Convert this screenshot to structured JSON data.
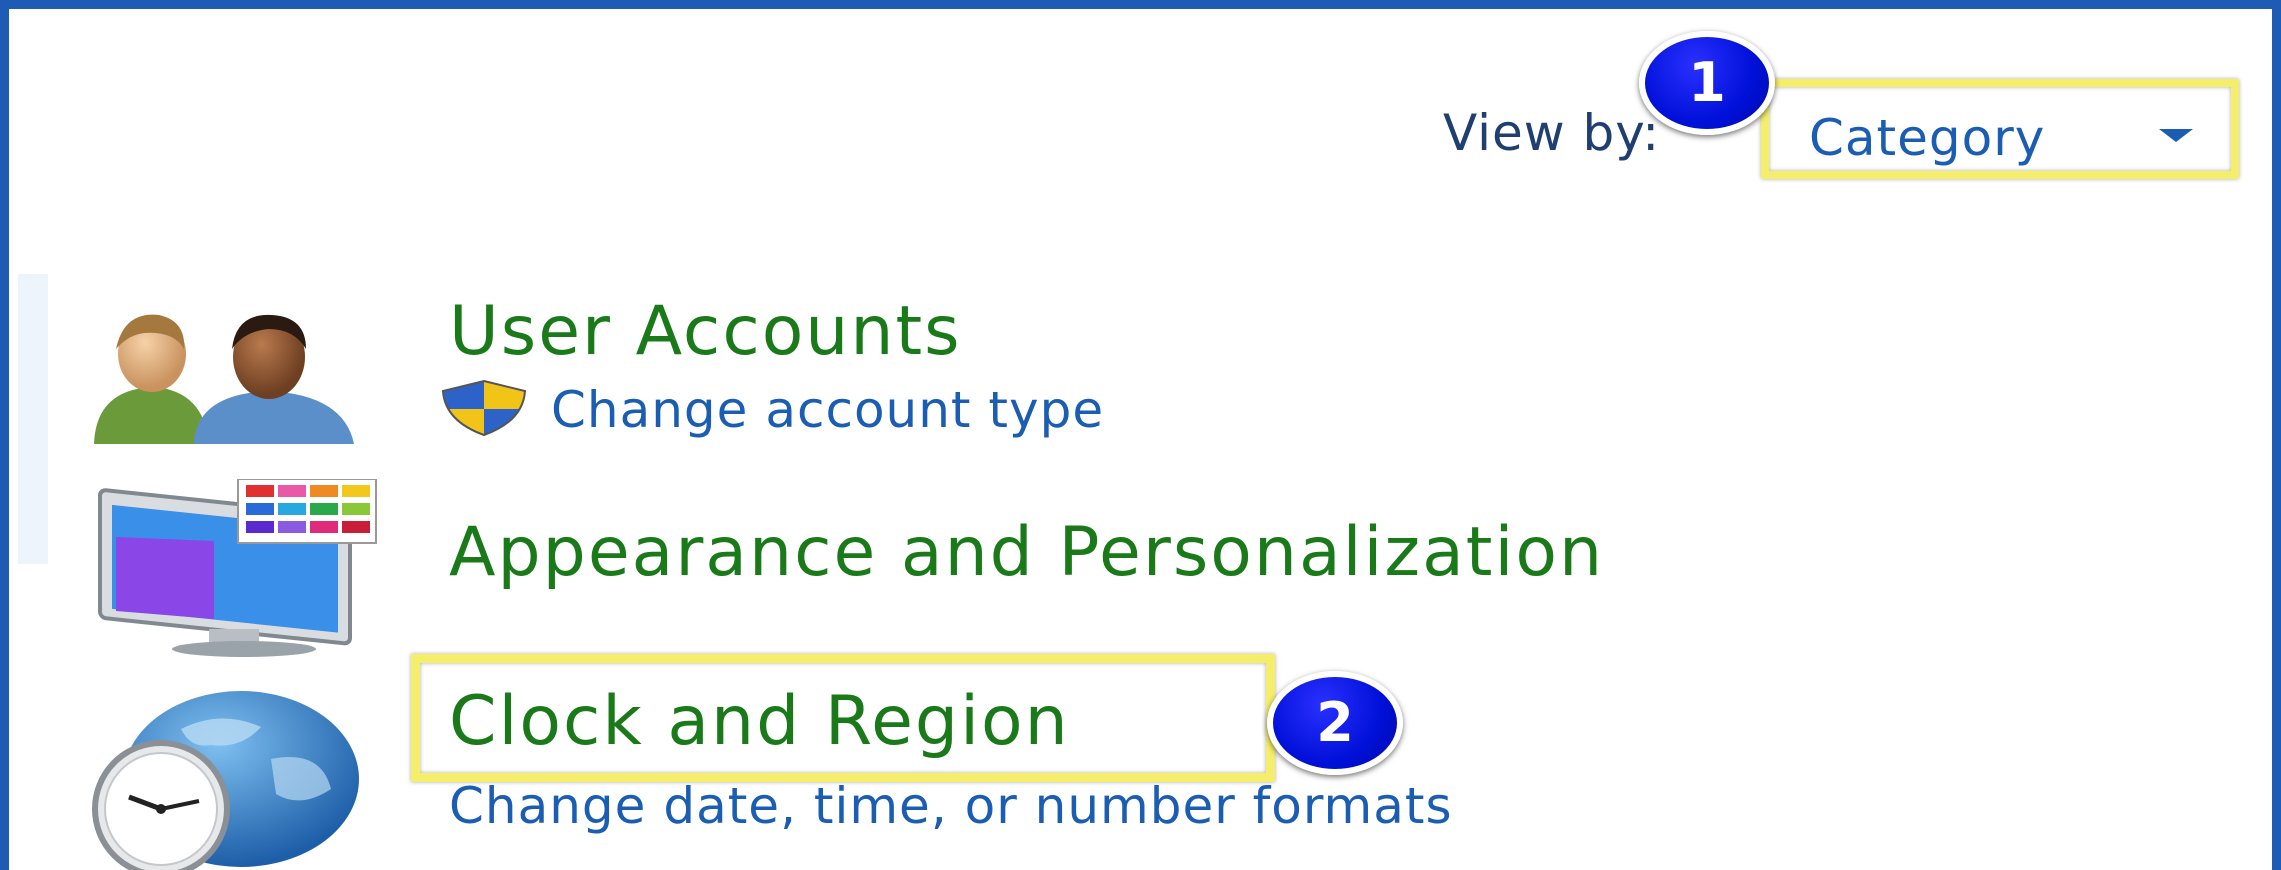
{
  "header": {
    "view_by_label": "View by:",
    "view_by_value": "Category",
    "dropdown_arrow_icon": "caret-down-icon"
  },
  "annotations": {
    "badge_1": "1",
    "badge_2": "2",
    "highlight_color": "#f4ee6a",
    "badge_color": "#0010d8"
  },
  "categories": [
    {
      "title": "User Accounts",
      "icon": "users-icon",
      "links": [
        {
          "label": "Change account type",
          "icon": "uac-shield-icon"
        }
      ]
    },
    {
      "title": "Appearance and Personalization",
      "icon": "monitor-color-palette-icon",
      "links": []
    },
    {
      "title": "Clock and Region",
      "icon": "globe-clock-icon",
      "links": [
        {
          "label": "Change date, time, or number formats"
        }
      ]
    }
  ],
  "colors": {
    "frame_border": "#1e5bb5",
    "category_title": "#1a7a1a",
    "link": "#1a5db3",
    "label": "#1f3f70"
  }
}
